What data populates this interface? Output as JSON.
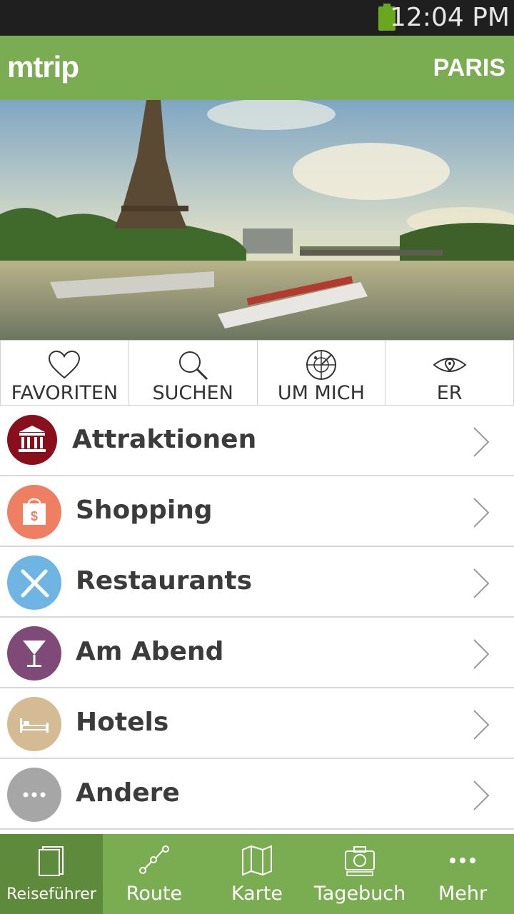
{
  "status_bar": {
    "time": "12:04 PM",
    "battery_icon": "battery-icon"
  },
  "app_bar": {
    "brand": "mtrip",
    "city": "PARIS"
  },
  "hero": {
    "image_icon": "eiffel-tower-seine-photo"
  },
  "quick_actions": [
    {
      "label": "FAVORITEN",
      "icon": "heart-icon"
    },
    {
      "label": "SUCHEN",
      "icon": "search-icon"
    },
    {
      "label": "UM MICH",
      "icon": "radar-icon"
    },
    {
      "label": "ER",
      "icon": "eye-icon"
    }
  ],
  "categories": [
    {
      "label": "Attraktionen",
      "icon": "museum-icon",
      "color": "#8a0f1c"
    },
    {
      "label": "Shopping",
      "icon": "shopping-bag-icon",
      "color": "#ef7f62"
    },
    {
      "label": "Restaurants",
      "icon": "fork-knife-icon",
      "color": "#6fb5e4"
    },
    {
      "label": "Am Abend",
      "icon": "cocktail-icon",
      "color": "#7f4a77"
    },
    {
      "label": "Hotels",
      "icon": "bed-icon",
      "color": "#d4bb93"
    },
    {
      "label": "Andere",
      "icon": "more-dots-icon",
      "color": "#a6a6a6"
    }
  ],
  "bottom_nav": [
    {
      "label": "Reiseführer",
      "icon": "guidebook-icon",
      "active": true
    },
    {
      "label": "Route",
      "icon": "route-icon"
    },
    {
      "label": "Karte",
      "icon": "map-icon"
    },
    {
      "label": "Tagebuch",
      "icon": "camera-icon"
    },
    {
      "label": "Mehr",
      "icon": "more-icon"
    }
  ],
  "colors": {
    "brand_green": "#7aac52",
    "active_nav": "#5e8a3c"
  }
}
